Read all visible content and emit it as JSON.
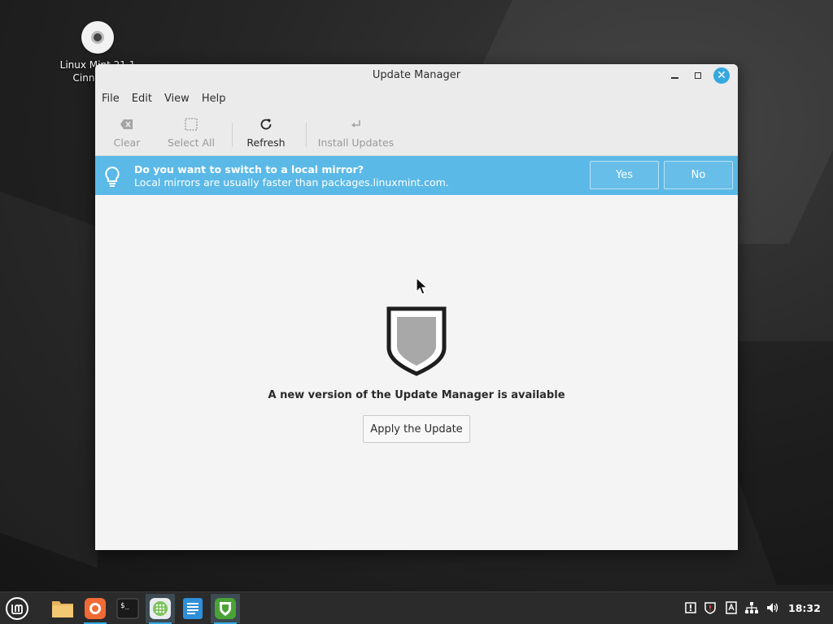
{
  "desktop": {
    "icon_label_line1": "Linux Mint 21.1",
    "icon_label_line2": "Cinnamon"
  },
  "window": {
    "title": "Update Manager",
    "menu": [
      "File",
      "Edit",
      "View",
      "Help"
    ],
    "toolbar": {
      "clear": "Clear",
      "select_all": "Select All",
      "refresh": "Refresh",
      "install_updates": "Install Updates"
    },
    "infobar": {
      "title": "Do you want to switch to a local mirror?",
      "subtitle": "Local mirrors are usually faster than packages.linuxmint.com.",
      "yes": "Yes",
      "no": "No"
    },
    "main": {
      "message": "A new version of the Update Manager is available",
      "apply_button": "Apply the Update"
    }
  },
  "taskbar": {
    "clock": "18:32",
    "apps": [
      "files-icon",
      "firefox-icon",
      "terminal-icon",
      "software-manager-icon",
      "text-editor-icon",
      "update-manager-icon"
    ]
  },
  "colors": {
    "accent": "#35a8e0",
    "infobar": "#5bb9e7",
    "window_bg": "#f4f4f4"
  }
}
